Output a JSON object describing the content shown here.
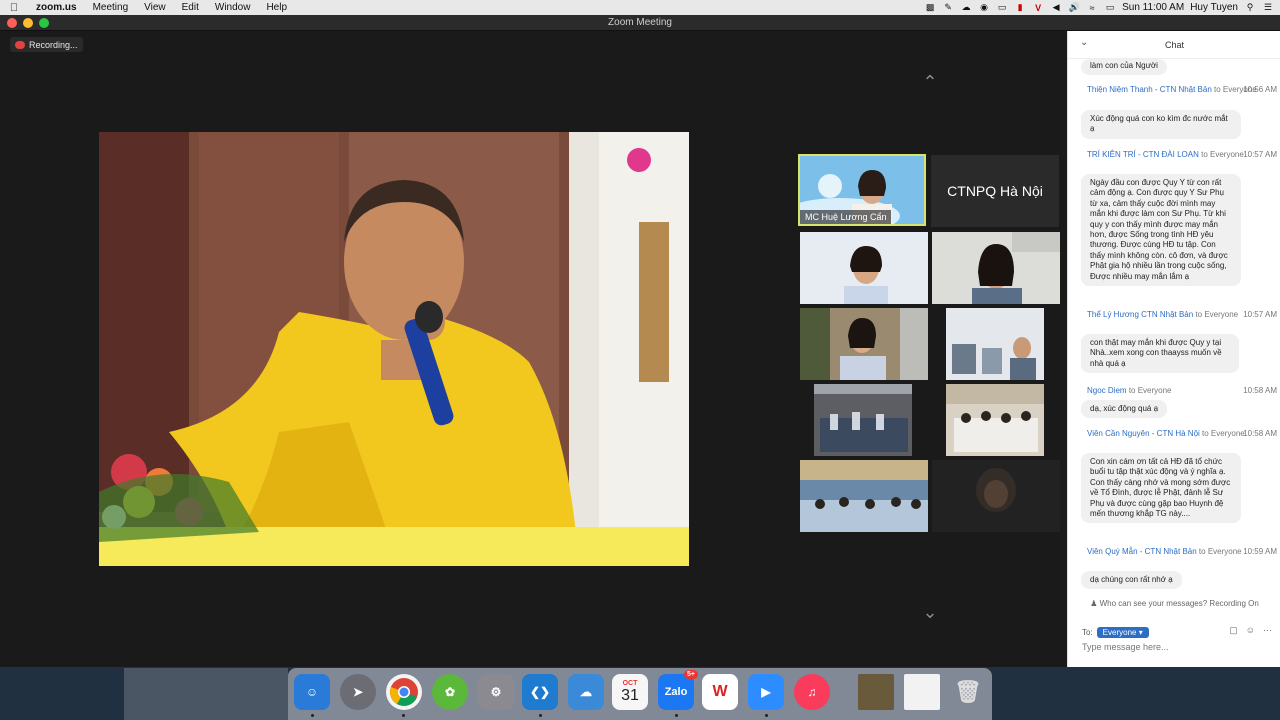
{
  "menubar": {
    "app": "zoom.us",
    "items": [
      "Meeting",
      "View",
      "Edit",
      "Window",
      "Help"
    ],
    "clock": "Sun 11:00 AM",
    "user": "Huy Tuyen"
  },
  "window": {
    "title": "Zoom Meeting"
  },
  "recording": {
    "label": "Recording..."
  },
  "tiles": {
    "host_name": "MC Huệ Lương Cẩn",
    "ctnpq_label": "CTNPQ Hà Nội"
  },
  "chat": {
    "title": "Chat",
    "partial_top": "làm con của Người",
    "messages": [
      {
        "sender": "Thiện Niệm Thanh - CTN Nhật Bản",
        "to": "to Everyone",
        "time": "10:56 AM",
        "text": "Xúc động quá con ko kìm đc nước mắt ạ"
      },
      {
        "sender": "TRÍ KIÊN TRÍ - CTN ĐÀI LOAN",
        "to": "to Everyone",
        "time": "10:57 AM",
        "text": "Ngày đầu con được Quy Y từ con rất cảm động ạ. Con được quy Y Sư Phụ từ xa, cảm thấy cuộc đời mình may mắn khi được làm con Sư Phụ. Từ khi quy y con thấy mình được may mắn hơn, được Sống trong tình HĐ yêu thương. Được cùng HĐ tu tập. Con thấy mình không còn. cô đơn, và được Phật gia hộ nhiều lần trong cuộc sống, Được nhiều may mắn lắm ạ"
      },
      {
        "sender": "Thể Lý Hương CTN Nhật Bản",
        "to": "to Everyone",
        "time": "10:57 AM",
        "text": "con thật may mắn khi được Quy y tại Nhà..xem xong con thaayss muốn về nhà quá ạ"
      },
      {
        "sender": "Ngoc Diem",
        "to": "to Everyone",
        "time": "10:58 AM",
        "text": "dạ, xúc động quá ạ"
      },
      {
        "sender": "Viên Cần Nguyên - CTN Hà Nội",
        "to": "to Everyone",
        "time": "10:58 AM",
        "text": "Con xin cám ơn tất cả HĐ đã tổ chức buổi tu tập thật xúc động và ý nghĩa ạ. Con thấy càng nhớ và mong sớm được về Tổ Đình, được lễ Phật, đảnh lễ Sư Phụ và được cùng gặp bao Huynh đệ mến thương khắp TG này...."
      },
      {
        "sender": "Viên Quý Mẫn - CTN Nhật Bản",
        "to": "to Everyone",
        "time": "10:59 AM",
        "text": "dạ chúng con rất nhớ ạ"
      }
    ],
    "who_can_see": "Who can see your messages? Recording On",
    "to_label": "To:",
    "to_value": "Everyone",
    "input_placeholder": "Type message here..."
  },
  "dock": {
    "calendar_month": "OCT",
    "calendar_day": "31",
    "zalo_badge": "5+",
    "zalo_label": "Zalo"
  }
}
